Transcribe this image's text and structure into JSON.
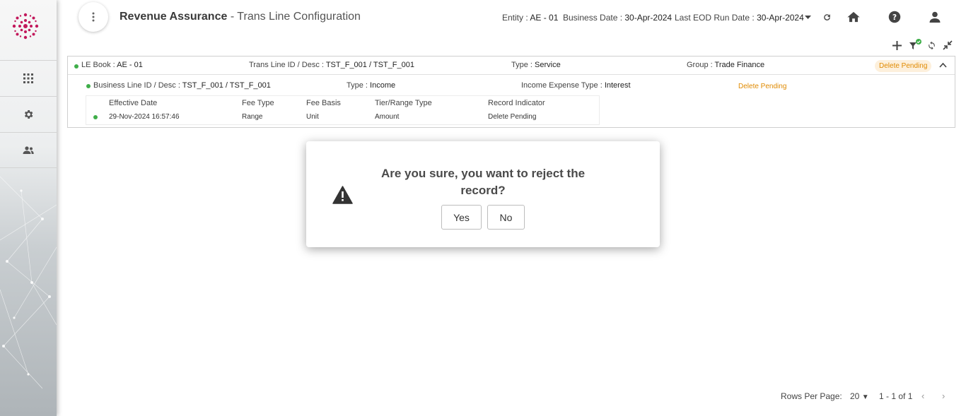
{
  "header": {
    "title_bold": "Revenue Assurance",
    "title_rest": " - Trans Line Configuration",
    "entity_label": "Entity : ",
    "entity_value": "AE - 01",
    "business_date_label": "Business Date : ",
    "business_date_value": "30-Apr-2024",
    "eod_label": "Last EOD Run Date : ",
    "eod_value": "30-Apr-2024"
  },
  "record": {
    "le_book_label": "LE Book : ",
    "le_book_value": "AE - 01",
    "trans_line_label": "Trans Line ID / Desc : ",
    "trans_line_value": "TST_F_001 / TST_F_001",
    "type_label": "Type : ",
    "type_value": "Service",
    "group_label": "Group : ",
    "group_value": "Trade Finance",
    "status": "Delete Pending"
  },
  "business_line": {
    "id_label": "Business Line ID / Desc : ",
    "id_value": "TST_F_001 / TST_F_001",
    "type_label": "Type : ",
    "type_value": "Income",
    "income_expense_label": "Income Expense Type : ",
    "income_expense_value": "Interest",
    "status": "Delete Pending"
  },
  "fee_table": {
    "headers": [
      "Effective Date",
      "Fee Type",
      "Fee Basis",
      "Tier/Range Type",
      "Record Indicator"
    ],
    "rows": [
      [
        "29-Nov-2024 16:57:46",
        "Range",
        "Unit",
        "Amount",
        "Delete Pending"
      ]
    ]
  },
  "dialog": {
    "message": "Are you sure, you want to reject the record?",
    "yes_label": "Yes",
    "no_label": "No"
  },
  "pagination": {
    "rows_per_page_label": "Rows Per Page:",
    "rows_per_page_value": "20",
    "range_text": "1 - 1 of 1"
  },
  "colors": {
    "accent_magenta": "#c2185b",
    "status_green": "#3fae49",
    "pending_orange": "#e08a00"
  },
  "icons": [
    "apps-grid-icon",
    "settings-icon",
    "users-icon",
    "kebab-menu-icon",
    "refresh-icon",
    "home-icon",
    "help-icon",
    "user-icon",
    "add-icon",
    "filter-icon",
    "sync-icon",
    "collapse-icon",
    "chevron-up-icon",
    "warning-icon"
  ]
}
